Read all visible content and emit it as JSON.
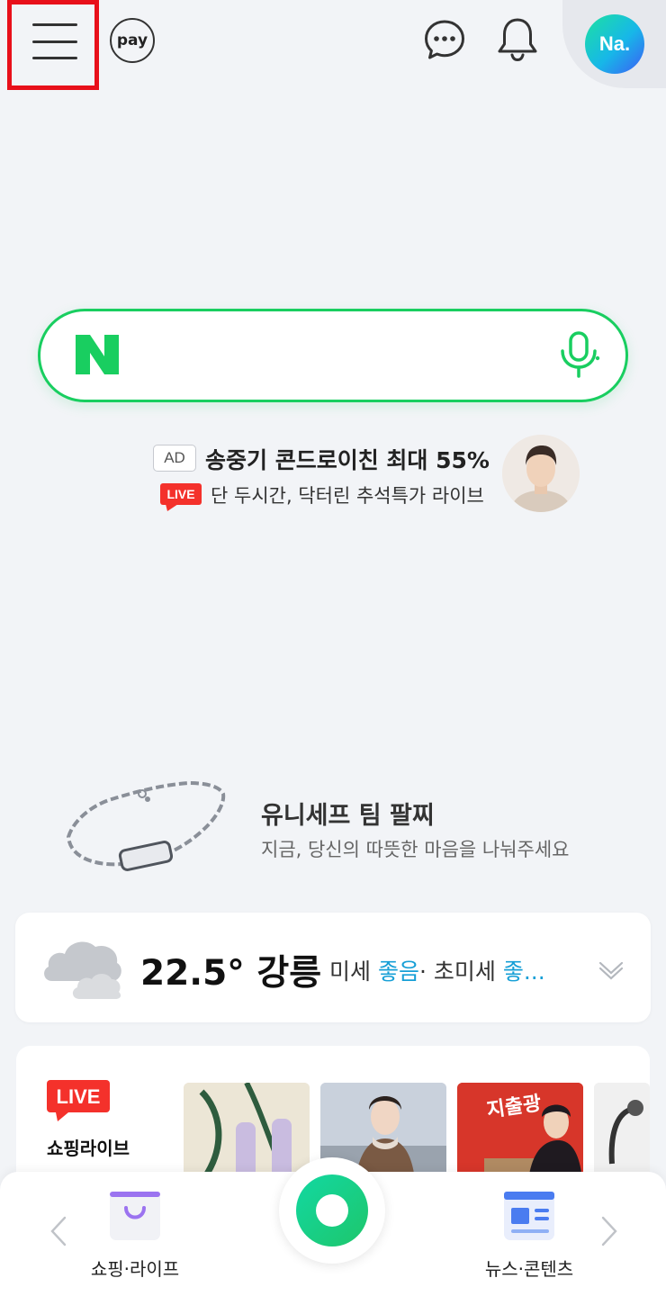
{
  "top_bar": {
    "pay_label": "pay",
    "profile_label": "Na."
  },
  "search": {
    "logo_text": "N"
  },
  "ad": {
    "badge": "AD",
    "title": "송중기 콘드로이친 최대 55%",
    "live_badge": "LIVE",
    "subtitle": "단 두시간, 닥터린 추석특가 라이브"
  },
  "promo": {
    "title": "유니세프 팀 팔찌",
    "subtitle": "지금, 당신의 따뜻한 마음을 나눠주세요"
  },
  "weather": {
    "temperature": "22.5°",
    "location": "강릉",
    "fine_dust_label": "미세",
    "fine_dust_value": "좋음",
    "separator": "·",
    "ultrafine_dust_label": "초미세",
    "ultrafine_dust_value": "좋..."
  },
  "shopping_live": {
    "badge": "LIVE",
    "label": "쇼핑라이브",
    "thumb_3_text": "지출광"
  },
  "bottom_nav": {
    "left_label": "쇼핑·라이프",
    "right_label": "뉴스·콘텐츠"
  },
  "colors": {
    "naver_green": "#19ce60",
    "live_red": "#f4312b",
    "good_status_blue": "#169fd6",
    "menu_highlight_red": "#e8101a"
  }
}
